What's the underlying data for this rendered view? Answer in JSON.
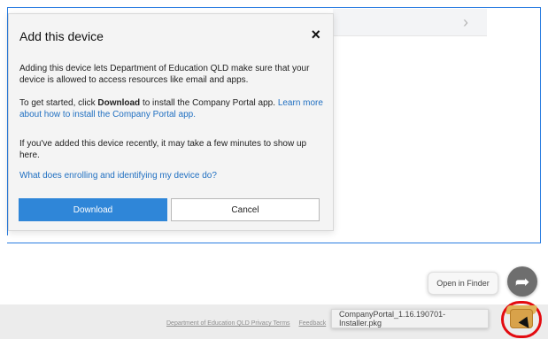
{
  "dialog": {
    "title": "Add this device",
    "close_icon": "×",
    "paragraphs": {
      "p1": "Adding this device lets Department of Education QLD make sure that your device is allowed to access resources like email and apps.",
      "p2_prefix": "To get started, click ",
      "p2_bold": "Download",
      "p2_middle": " to install the Company Portal app. ",
      "p2_link": "Learn more about how to install the Company Portal app.",
      "p3": "If you've added this device recently, it may take a few minutes to show up here.",
      "p4": "What does enrolling and identifying my device do?"
    },
    "buttons": {
      "download": "Download",
      "cancel": "Cancel"
    }
  },
  "browser": {
    "chevron_right": "›",
    "finder_button": "Open in Finder",
    "footer": {
      "privacy_terms": "Department of Education QLD Privacy Terms",
      "feedback": "Feedback"
    },
    "download_tip": "CompanyPortal_1.16.190701-Installer.pkg"
  }
}
